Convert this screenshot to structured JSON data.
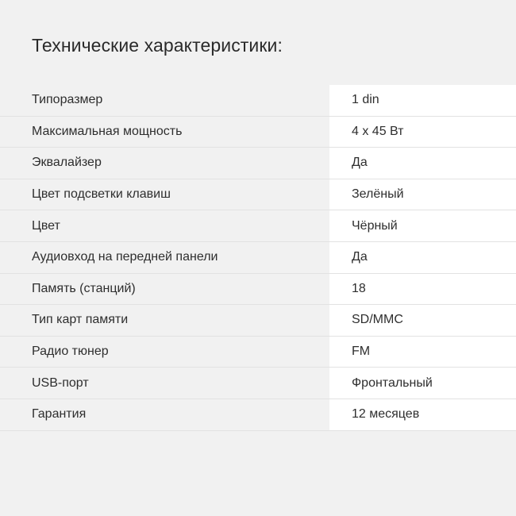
{
  "title": "Технические характеристики:",
  "specs": [
    {
      "label": "Типоразмер",
      "value": "1 din"
    },
    {
      "label": "Максимальная мощность",
      "value": "4 х 45 Вт"
    },
    {
      "label": "Эквалайзер",
      "value": "Да"
    },
    {
      "label": "Цвет подсветки клавиш",
      "value": "Зелёный"
    },
    {
      "label": "Цвет",
      "value": "Чёрный"
    },
    {
      "label": "Аудиовход на передней панели",
      "value": "Да"
    },
    {
      "label": "Память (станций)",
      "value": "18"
    },
    {
      "label": "Тип карт памяти",
      "value": "SD/MMC"
    },
    {
      "label": "Радио тюнер",
      "value": "FM"
    },
    {
      "label": "USB-порт",
      "value": "Фронтальный"
    },
    {
      "label": "Гарантия",
      "value": "12 месяцев"
    }
  ]
}
